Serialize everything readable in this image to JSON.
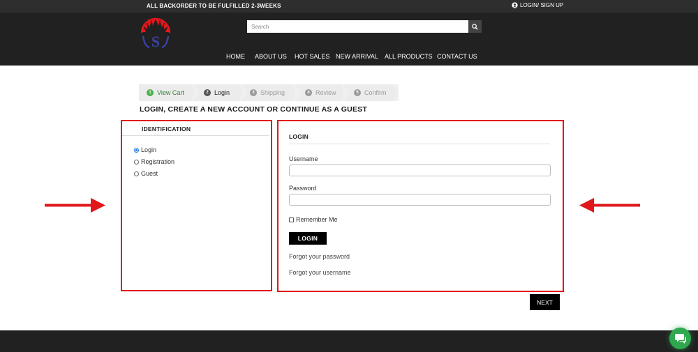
{
  "topbar": {
    "announcement": "ALL BACKORDER TO BE FULFILLED 2-3WEEKS",
    "account_link": "LOGIN/ SIGN UP"
  },
  "header": {
    "search_placeholder": "Search",
    "nav": [
      "HOME",
      "ABOUT US",
      "HOT SALES",
      "NEW ARRIVAL",
      "ALL PRODUCTS",
      "CONTACT US"
    ]
  },
  "steps": [
    {
      "num": "1",
      "label": "View Cart",
      "state": "done"
    },
    {
      "num": "2",
      "label": "Login",
      "state": "active"
    },
    {
      "num": "3",
      "label": "Shipping",
      "state": "todo"
    },
    {
      "num": "4",
      "label": "Review",
      "state": "todo"
    },
    {
      "num": "5",
      "label": "Confirm",
      "state": "todo"
    }
  ],
  "page_heading": "LOGIN, CREATE A NEW ACCOUNT OR CONTINUE AS A GUEST",
  "identification": {
    "title": "IDENTIFICATION",
    "options": [
      {
        "label": "Login",
        "selected": true
      },
      {
        "label": "Registration",
        "selected": false
      },
      {
        "label": "Guest",
        "selected": false
      }
    ]
  },
  "login_panel": {
    "title": "LOGIN",
    "username_label": "Username",
    "username_value": "",
    "password_label": "Password",
    "password_value": "",
    "remember_label": "Remember Me",
    "remember_checked": false,
    "login_button": "LOGIN",
    "forgot_password": "Forgot your password",
    "forgot_username": "Forgot your username"
  },
  "next_button": "NEXT",
  "colors": {
    "header_bg": "#212121",
    "topbar_bg": "#2e2e2e",
    "highlight_red": "#e0171b",
    "step_done_green": "#4caf50",
    "chat_green": "#2fa84f"
  }
}
